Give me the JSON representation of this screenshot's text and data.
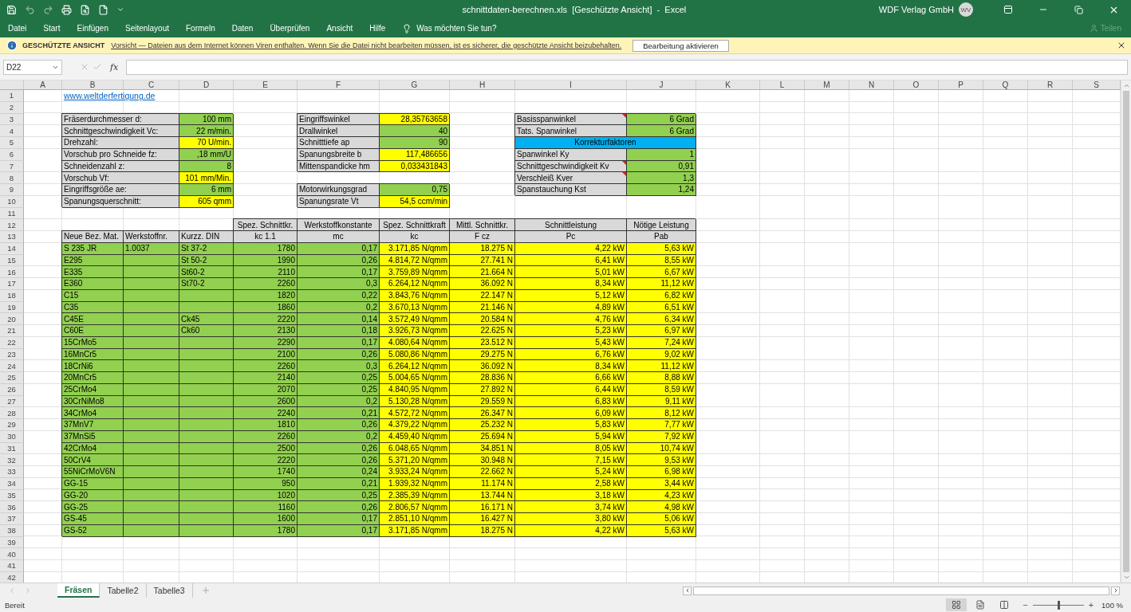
{
  "window": {
    "title": "schnittdaten-berechnen.xls  [Geschützte Ansicht]  -  Excel",
    "user": "WDF Verlag GmbH",
    "initials": "WV"
  },
  "menu": [
    {
      "label": "Datei"
    },
    {
      "label": "Start"
    },
    {
      "label": "Einfügen"
    },
    {
      "label": "Seitenlayout"
    },
    {
      "label": "Formeln"
    },
    {
      "label": "Daten"
    },
    {
      "label": "Überprüfen"
    },
    {
      "label": "Ansicht"
    },
    {
      "label": "Hilfe"
    }
  ],
  "tell_me": {
    "placeholder": "Was möchten Sie tun?"
  },
  "share": {
    "label": "Teilen",
    "disabled": true
  },
  "protected_view": {
    "title": "GESCHÜTZTE ANSICHT",
    "message": "Vorsicht — Dateien aus dem Internet können Viren enthalten. Wenn Sie die Datei nicht bearbeiten müssen, ist es sicherer, die geschützte Ansicht beizubehalten.",
    "button": "Bearbeitung aktivieren"
  },
  "formula_bar": {
    "name_box": "D22",
    "function_label": "fx"
  },
  "sheet": {
    "columns": [
      "A",
      "B",
      "C",
      "D",
      "E",
      "F",
      "G",
      "H",
      "I",
      "J",
      "K",
      "L",
      "M",
      "N",
      "O",
      "P",
      "Q",
      "R",
      "S"
    ],
    "row_numbers": [
      "1",
      "2",
      "3",
      "4",
      "5",
      "6",
      "7",
      "8",
      "9",
      "10",
      "11",
      "12",
      "13",
      "14",
      "15",
      "16",
      "17",
      "18",
      "19",
      "20",
      "21",
      "22",
      "23",
      "24",
      "25",
      "26",
      "27",
      "28",
      "29",
      "30",
      "31",
      "32",
      "33",
      "34",
      "35",
      "36",
      "37",
      "38",
      "39",
      "40",
      "41",
      "42"
    ],
    "link": "www.weltderfertigung.de",
    "left_params": [
      {
        "label": "Fräserdurchmesser d:",
        "value": "100 mm",
        "color": "#92d050"
      },
      {
        "label": "Schnittgeschwindigkeit Vc:",
        "value": "22 m/min.",
        "color": "#92d050"
      },
      {
        "label": "Drehzahl:",
        "value": "70 U/min.",
        "color": "#ffff00"
      },
      {
        "label": "Vorschub pro Schneide fz:",
        "value": ",18 mm/U",
        "color": "#92d050"
      },
      {
        "label": "Schneidenzahl z:",
        "value": "8",
        "color": "#92d050"
      },
      {
        "label": "Vorschub Vf:",
        "value": "101 mm/Min.",
        "color": "#ffff00"
      },
      {
        "label": "Eingriffsgröße ae:",
        "value": "6 mm",
        "color": "#92d050"
      },
      {
        "label": "Spanungsquerschnitt:",
        "value": "605 qmm",
        "color": "#ffff00"
      }
    ],
    "mid_params": [
      {
        "kind": "pair",
        "label": "Eingriffswinkel",
        "value": "28,35763658",
        "color": "#ffff00"
      },
      {
        "kind": "pair",
        "label": "Drallwinkel",
        "value": "40",
        "color": "#92d050"
      },
      {
        "kind": "pair",
        "label": "Schnitttiefe ap",
        "value": "90",
        "color": "#92d050"
      },
      {
        "kind": "pair",
        "label": "Spanungsbreite b",
        "value": "117,486656",
        "color": "#ffff00"
      },
      {
        "kind": "pair",
        "label": "Mittenspandicke hm",
        "value": "0,033431843",
        "color": "#ffff00"
      },
      {
        "kind": "blank"
      },
      {
        "kind": "pair",
        "label": "Motorwirkungsgrad",
        "value": "0,75",
        "color": "#92d050"
      },
      {
        "kind": "pair",
        "label": "Spanungsrate Vt",
        "value": "54,5 ccm/min",
        "color": "#ffff00"
      }
    ],
    "right_params": [
      {
        "kind": "pair",
        "label": "Basisspanwinkel",
        "value": "6 Grad",
        "comment": true
      },
      {
        "kind": "pair",
        "label": "Tats. Spanwinkel",
        "value": "6 Grad",
        "comment": false
      },
      {
        "kind": "section",
        "label": "Korrekturfaktoren"
      },
      {
        "kind": "pair",
        "label": "Spanwinkel Ky",
        "value": "1",
        "comment": false
      },
      {
        "kind": "pair",
        "label": "Schnittgeschwindigkeit Kv",
        "value": "0,91",
        "comment": true
      },
      {
        "kind": "pair",
        "label": "Verschleiß Kver",
        "value": "1,3",
        "comment": true
      },
      {
        "kind": "pair",
        "label": "Spanstauchung Kst",
        "value": "1,24",
        "comment": false
      }
    ],
    "table": {
      "columns": [
        {
          "subheading": "Neue Bez. Mat.",
          "color": "#92d050"
        },
        {
          "subheading": "Werkstoffnr.",
          "color": "#92d050"
        },
        {
          "subheading": "Kurzz. DIN",
          "color": "#92d050"
        },
        {
          "heading": "Spez. Schnittkr.",
          "subheading": "kc 1.1",
          "color": "#92d050"
        },
        {
          "heading": "Werkstoffkonstante",
          "subheading": "mc",
          "color": "#92d050"
        },
        {
          "heading": "Spez. Schnittkraft",
          "subheading": "kc",
          "color": "#ffff00"
        },
        {
          "heading": "Mittl. Schnittkr.",
          "subheading": "F cz",
          "color": "#ffff00"
        },
        {
          "heading": "Schnittleistung",
          "subheading": "Pc",
          "color": "#ffff00"
        },
        {
          "heading": "Nötige Leistung",
          "subheading": "Pab",
          "color": "#ffff00"
        }
      ],
      "rows": [
        {
          "material": "S 235 JR",
          "number": "1.0037",
          "din": "St 37-2",
          "values": [
            "1780",
            "0,17",
            "3.171,85 N/qmm",
            "18.275 N",
            "4,22 kW",
            "5,63 kW"
          ]
        },
        {
          "material": "E295",
          "din": "St 50-2",
          "values": [
            "1990",
            "0,26",
            "4.814,72 N/qmm",
            "27.741 N",
            "6,41 kW",
            "8,55 kW"
          ]
        },
        {
          "material": "E335",
          "din": "St60-2",
          "values": [
            "2110",
            "0,17",
            "3.759,89 N/qmm",
            "21.664 N",
            "5,01 kW",
            "6,67 kW"
          ]
        },
        {
          "material": "E360",
          "din": "St70-2",
          "values": [
            "2260",
            "0,3",
            "6.264,12 N/qmm",
            "36.092 N",
            "8,34 kW",
            "11,12 kW"
          ]
        },
        {
          "material": "C15",
          "values": [
            "1820",
            "0,22",
            "3.843,76 N/qmm",
            "22.147 N",
            "5,12 kW",
            "6,82 kW"
          ]
        },
        {
          "material": "C35",
          "values": [
            "1860",
            "0,2",
            "3.670,13 N/qmm",
            "21.146 N",
            "4,89 kW",
            "6,51 kW"
          ]
        },
        {
          "material": "C45E",
          "din": "Ck45",
          "values": [
            "2220",
            "0,14",
            "3.572,49 N/qmm",
            "20.584 N",
            "4,76 kW",
            "6,34 kW"
          ]
        },
        {
          "material": "C60E",
          "din": "Ck60",
          "values": [
            "2130",
            "0,18",
            "3.926,73 N/qmm",
            "22.625 N",
            "5,23 kW",
            "6,97 kW"
          ]
        },
        {
          "material": "15CrMo5",
          "values": [
            "2290",
            "0,17",
            "4.080,64 N/qmm",
            "23.512 N",
            "5,43 kW",
            "7,24 kW"
          ]
        },
        {
          "material": "16MnCr5",
          "values": [
            "2100",
            "0,26",
            "5.080,86 N/qmm",
            "29.275 N",
            "6,76 kW",
            "9,02 kW"
          ]
        },
        {
          "material": "18CrNi6",
          "values": [
            "2260",
            "0,3",
            "6.264,12 N/qmm",
            "36.092 N",
            "8,34 kW",
            "11,12 kW"
          ]
        },
        {
          "material": "20MnCr5",
          "values": [
            "2140",
            "0,25",
            "5.004,65 N/qmm",
            "28.836 N",
            "6,66 kW",
            "8,88 kW"
          ]
        },
        {
          "material": "25CrMo4",
          "values": [
            "2070",
            "0,25",
            "4.840,95 N/qmm",
            "27.892 N",
            "6,44 kW",
            "8,59 kW"
          ]
        },
        {
          "material": "30CrNiMo8",
          "values": [
            "2600",
            "0,2",
            "5.130,28 N/qmm",
            "29.559 N",
            "6,83 kW",
            "9,11 kW"
          ]
        },
        {
          "material": "34CrMo4",
          "values": [
            "2240",
            "0,21",
            "4.572,72 N/qmm",
            "26.347 N",
            "6,09 kW",
            "8,12 kW"
          ]
        },
        {
          "material": "37MnV7",
          "values": [
            "1810",
            "0,26",
            "4.379,22 N/qmm",
            "25.232 N",
            "5,83 kW",
            "7,77 kW"
          ]
        },
        {
          "material": "37MnSi5",
          "values": [
            "2260",
            "0,2",
            "4.459,40 N/qmm",
            "25.694 N",
            "5,94 kW",
            "7,92 kW"
          ]
        },
        {
          "material": "42CrMo4",
          "values": [
            "2500",
            "0,26",
            "6.048,65 N/qmm",
            "34.851 N",
            "8,05 kW",
            "10,74 kW"
          ]
        },
        {
          "material": "50CrV4",
          "values": [
            "2220",
            "0,26",
            "5.371,20 N/qmm",
            "30.948 N",
            "7,15 kW",
            "9,53 kW"
          ]
        },
        {
          "material": "55NiCrMoV6N",
          "values": [
            "1740",
            "0,24",
            "3.933,24 N/qmm",
            "22.662 N",
            "5,24 kW",
            "6,98 kW"
          ]
        },
        {
          "material": "GG-15",
          "values": [
            "950",
            "0,21",
            "1.939,32 N/qmm",
            "11.174 N",
            "2,58 kW",
            "3,44 kW"
          ]
        },
        {
          "material": "GG-20",
          "values": [
            "1020",
            "0,25",
            "2.385,39 N/qmm",
            "13.744 N",
            "3,18 kW",
            "4,23 kW"
          ]
        },
        {
          "material": "GG-25",
          "values": [
            "1160",
            "0,26",
            "2.806,57 N/qmm",
            "16.171 N",
            "3,74 kW",
            "4,98 kW"
          ]
        },
        {
          "material": "GS-45",
          "values": [
            "1600",
            "0,17",
            "2.851,10 N/qmm",
            "16.427 N",
            "3,80 kW",
            "5,06 kW"
          ]
        },
        {
          "material": "GS-52",
          "values": [
            "1780",
            "0,17",
            "3.171,85 N/qmm",
            "18.275 N",
            "4,22 kW",
            "5,63 kW"
          ]
        }
      ]
    }
  },
  "sheet_tabs": [
    {
      "label": "Fräsen",
      "selected": true
    },
    {
      "label": "Tabelle2",
      "selected": false
    },
    {
      "label": "Tabelle3",
      "selected": false
    }
  ],
  "status_bar": {
    "status": "Bereit",
    "views": [
      {
        "kind": "normal",
        "selected": true
      },
      {
        "kind": "layout",
        "selected": false
      },
      {
        "kind": "pagebreak",
        "selected": false
      }
    ],
    "zoom_minus": "−",
    "zoom_plus": "+",
    "zoom": {
      "level": 0.5
    },
    "zoom_label": "100 %"
  }
}
